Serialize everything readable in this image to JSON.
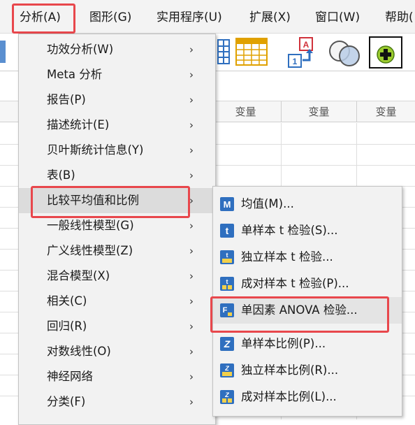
{
  "menubar": {
    "items": [
      {
        "label": "分析(A)"
      },
      {
        "label": "图形(G)"
      },
      {
        "label": "实用程序(U)"
      },
      {
        "label": "扩展(X)"
      },
      {
        "label": "窗口(W)"
      },
      {
        "label": "帮助("
      }
    ]
  },
  "grid": {
    "column_headers": [
      "变量",
      "变量",
      "变量"
    ]
  },
  "analyze_menu": {
    "items": [
      {
        "label": "功效分析(W)"
      },
      {
        "label": "Meta 分析"
      },
      {
        "label": "报告(P)"
      },
      {
        "label": "描述统计(E)"
      },
      {
        "label": "贝叶斯统计信息(Y)"
      },
      {
        "label": "表(B)"
      },
      {
        "label": "比较平均值和比例"
      },
      {
        "label": "一般线性模型(G)"
      },
      {
        "label": "广义线性模型(Z)"
      },
      {
        "label": "混合模型(X)"
      },
      {
        "label": "相关(C)"
      },
      {
        "label": "回归(R)"
      },
      {
        "label": "对数线性(O)"
      },
      {
        "label": "神经网络"
      },
      {
        "label": "分类(F)"
      }
    ],
    "arrow": "›"
  },
  "compare_submenu": {
    "items": [
      {
        "label": "均值(M)...",
        "icon": "means-icon"
      },
      {
        "label": "单样本 t 检验(S)...",
        "icon": "one-sample-t-icon"
      },
      {
        "label": "独立样本 t 检验...",
        "icon": "independent-t-icon"
      },
      {
        "label": "成对样本 t 检验(P)...",
        "icon": "paired-t-icon"
      },
      {
        "label": "单因素 ANOVA 检验...",
        "icon": "anova-icon"
      },
      {
        "label": "单样本比例(P)...",
        "icon": "one-sample-prop-icon"
      },
      {
        "label": "独立样本比例(R)...",
        "icon": "independent-prop-icon"
      },
      {
        "label": "成对样本比例(L)...",
        "icon": "paired-prop-icon"
      }
    ]
  },
  "colors": {
    "highlight_border": "#e8474c",
    "icon_blue": "#2f6fbf"
  }
}
